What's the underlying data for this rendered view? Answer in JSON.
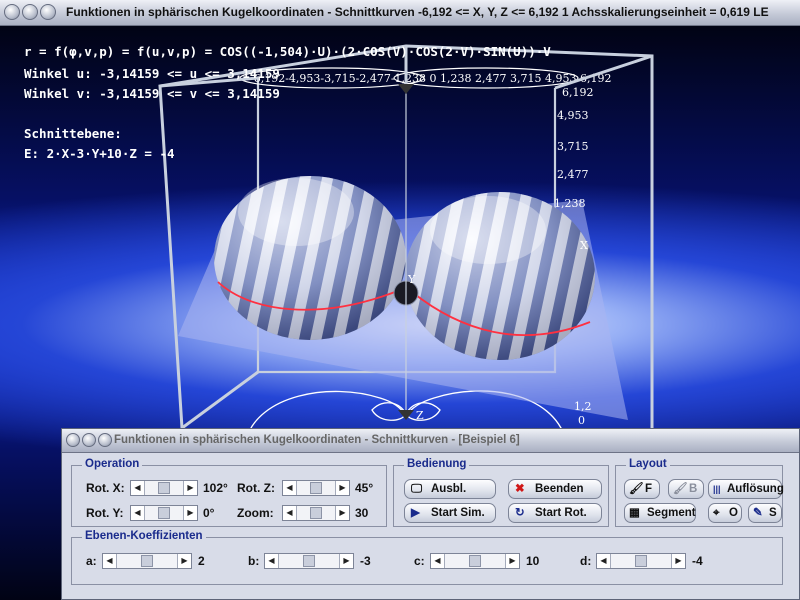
{
  "window": {
    "title": "Funktionen in sphärischen Kugelkoordinaten - Schnittkurven   -6,192 <= X, Y, Z <= 6,192   1 Achsskalierungseinheit = 0,619 LE"
  },
  "overlay": {
    "formula": "r = f(φ,v,p) = f(u,v,p) = COS((-1,504)·U)·(2·COS(V)·COS(2·V)·SIN(U))·V",
    "angle_u": "Winkel u: -3,14159 <= u <= 3,14159",
    "angle_v": "Winkel v: -3,14159 <= v <= 3,14159",
    "plane_heading": "Schnittebene:",
    "plane_equation": "E: 2·X-3·Y+10·Z = -4"
  },
  "axes": {
    "z_ticks": [
      "6,192",
      "4,953",
      "3,715",
      "2,477",
      "1,238"
    ],
    "x_ticks": "-6,192-4,953-3,715-2,477-1,238  0  1,238 2,477 3,715 4,953 6,192",
    "x_label": "X",
    "y_label": "Y",
    "z_label": "Z",
    "bottom_ticks": [
      "1,2",
      "0"
    ],
    "colors": {
      "frame": "#c8d0de",
      "curve": "#ff3040",
      "plane": "#aab4f0"
    }
  },
  "dialog": {
    "title": "Funktionen in sphärischen Kugelkoordinaten - Schnittkurven - [Beispiel 6]",
    "operation": {
      "label": "Operation",
      "rot_x_label": "Rot. X:",
      "rot_x_value": "102°",
      "rot_y_label": "Rot. Y:",
      "rot_y_value": "0°",
      "rot_z_label": "Rot. Z:",
      "rot_z_value": "45°",
      "zoom_label": "Zoom:",
      "zoom_value": "30"
    },
    "bedienung": {
      "label": "Bedienung",
      "ausbl": "Ausbl.",
      "beenden": "Beenden",
      "start_sim": "Start Sim.",
      "start_rot": "Start Rot."
    },
    "layout": {
      "label": "Layout",
      "f": "F",
      "b": "B",
      "aufloesung": "Auflösung",
      "segment": "Segment",
      "o": "O",
      "s": "S"
    },
    "coefficients": {
      "label": "Ebenen-Koeffizienten",
      "a_label": "a:",
      "a_value": "2",
      "b_label": "b:",
      "b_value": "-3",
      "c_label": "c:",
      "c_value": "10",
      "d_label": "d:",
      "d_value": "-4"
    }
  }
}
